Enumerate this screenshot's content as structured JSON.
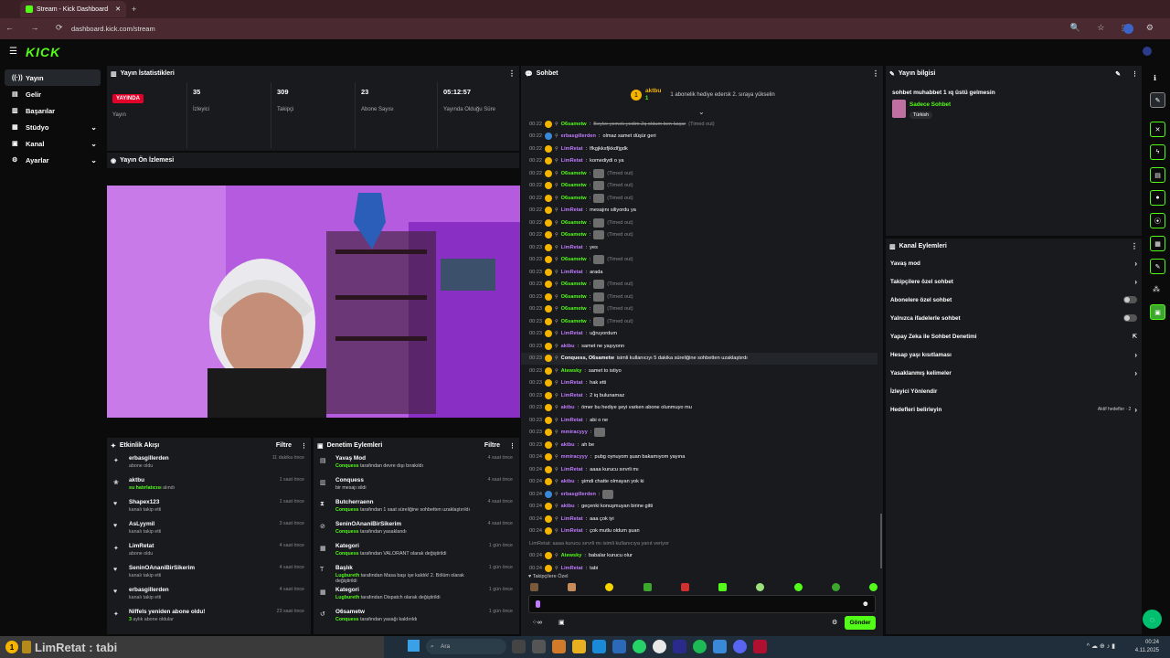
{
  "browser": {
    "tab_title": "Stream - Kick Dashboard",
    "url": "dashboard.kick.com/stream"
  },
  "brand": {
    "logo": "KICK",
    "accent": "#53fc18"
  },
  "nav": {
    "items": [
      {
        "label": "Yayın",
        "icon": "broadcast-icon"
      },
      {
        "label": "Gelir",
        "icon": "money-icon"
      },
      {
        "label": "Başarılar",
        "icon": "trophy-icon"
      },
      {
        "label": "Stüdyo",
        "icon": "studio-icon"
      },
      {
        "label": "Kanal",
        "icon": "channel-icon"
      },
      {
        "label": "Ayarlar",
        "icon": "gear-icon"
      }
    ]
  },
  "stats": {
    "title": "Yayın İstatistikleri",
    "live_badge": "YAYINDA",
    "live_label": "Yayın",
    "items": [
      {
        "value": "35",
        "label": "İzleyici"
      },
      {
        "value": "309",
        "label": "Takipçi"
      },
      {
        "value": "23",
        "label": "Abone Sayısı"
      },
      {
        "value": "05:12:57",
        "label": "Yayında Olduğu Süre"
      }
    ]
  },
  "preview": {
    "title": "Yayın Ön İzlemesi"
  },
  "activity": {
    "title": "Etkinlik Akışı",
    "filter": "Filtre",
    "items": [
      {
        "name": "erbasgillerden",
        "sub": "abone oldu",
        "time": "11 dakika önce"
      },
      {
        "name": "aktbu",
        "sub_hl": "su hatırlatıcısı",
        "sub": " alındı",
        "time": "1 saat önce"
      },
      {
        "name": "Shapex123",
        "sub": "kanalı takip etti",
        "time": "1 saat önce"
      },
      {
        "name": "AsLyymil",
        "sub": "kanalı takip etti",
        "time": "3 saat önce"
      },
      {
        "name": "LimRetat",
        "sub": "abone oldu",
        "time": "4 saat önce"
      },
      {
        "name": "SeninOAnaniBirSikerim",
        "sub": "kanalı takip etti",
        "time": "4 saat önce"
      },
      {
        "name": "erbasgillerden",
        "sub": "kanalı takip etti",
        "time": "4 saat önce"
      },
      {
        "name": "Niffels yeniden abone oldu!",
        "sub_hl": "3",
        "sub": " aylık abone oldular",
        "time": "23 saat önce"
      }
    ]
  },
  "moderation": {
    "title": "Denetim Eylemleri",
    "filter": "Filtre",
    "items": [
      {
        "name": "Yavaş Mod",
        "hl": "Conquess",
        "sub": " tarafından devre dışı bırakıldı",
        "time": "4 saat önce"
      },
      {
        "name": "Conquess",
        "hl": "",
        "sub": "bir mesajı sildi",
        "time": "4 saat önce"
      },
      {
        "name": "Butcherraenn",
        "hl": "Conquess",
        "sub": " tarafından 1 saat süreliğine sohbetten uzaklaştırıldı",
        "time": "4 saat önce"
      },
      {
        "name": "SeninOAnaniBirSikerim",
        "hl": "Conquess",
        "sub": " tarafından yasaklandı",
        "time": "4 saat önce"
      },
      {
        "name": "Kategori",
        "hl": "Conquess",
        "sub": " tarafından VALORANT olarak değiştirildi",
        "time": "1 gün önce"
      },
      {
        "name": "Başlık",
        "hl": "Lugbureth",
        "sub": " tarafından Masa başı işe kaldık! 2. Bölüm olarak değiştirildi",
        "time": "1 gün önce"
      },
      {
        "name": "Kategori",
        "hl": "Lugbureth",
        "sub": " tarafından Dispatch olarak değiştirildi",
        "time": "1 gün önce"
      },
      {
        "name": "O6sametw",
        "hl": "Conquess",
        "sub": " tarafından yasağı kaldırıldı",
        "time": "1 gün önce"
      }
    ]
  },
  "chat": {
    "title": "Sohbet",
    "pinned_user": "aktbu",
    "pinned_count": "1",
    "pinned_text": "1 abonelik hediye edersk 2. sıraya yükselin",
    "followers_only": "Takipçilere Özel",
    "send": "Gönder",
    "messages": [
      {
        "t": "00:22",
        "u": "O6sametw",
        "c": "#53fc18",
        "m": "Beyler yemek yedim 2q oldum ben kaçar",
        "x": "(Timed out)"
      },
      {
        "t": "00:22",
        "u": "erbasgillerden",
        "c": "#c07bff",
        "m": "olmaz samet düşür geri"
      },
      {
        "t": "00:22",
        "u": "LimRetat",
        "c": "#c07bff",
        "m": "lfkgjkksfjkkdfjgdk"
      },
      {
        "t": "00:22",
        "u": "LimRetat",
        "c": "#c07bff",
        "m": "komediydi o ya"
      },
      {
        "t": "00:22",
        "u": "O6sametw",
        "c": "#53fc18",
        "m": "",
        "x": "(Timed out)",
        "e": true
      },
      {
        "t": "00:22",
        "u": "O6sametw",
        "c": "#53fc18",
        "m": "",
        "x": "(Timed out)",
        "e": true
      },
      {
        "t": "00:22",
        "u": "O6sametw",
        "c": "#53fc18",
        "m": "",
        "x": "(Timed out)",
        "e": true
      },
      {
        "t": "00:22",
        "u": "LimRetat",
        "c": "#c07bff",
        "m": "mesajını siliyordu ya"
      },
      {
        "t": "00:22",
        "u": "O6sametw",
        "c": "#53fc18",
        "m": "",
        "x": "(Timed out)",
        "e": true
      },
      {
        "t": "00:22",
        "u": "O6sametw",
        "c": "#53fc18",
        "m": "",
        "x": "(Timed out)",
        "e": true
      },
      {
        "t": "00:23",
        "u": "LimRetat",
        "c": "#c07bff",
        "m": "yes"
      },
      {
        "t": "00:23",
        "u": "O6sametw",
        "c": "#53fc18",
        "m": "",
        "x": "(Timed out)",
        "e": true
      },
      {
        "t": "00:23",
        "u": "LimRetat",
        "c": "#c07bff",
        "m": "arada"
      },
      {
        "t": "00:23",
        "u": "O6sametw",
        "c": "#53fc18",
        "m": "",
        "x": "(Timed out)",
        "e": true
      },
      {
        "t": "00:23",
        "u": "O6sametw",
        "c": "#53fc18",
        "m": "",
        "x": "(Timed out)",
        "e": true
      },
      {
        "t": "00:23",
        "u": "O6sametw",
        "c": "#53fc18",
        "m": "",
        "x": "(Timed out)",
        "e": true
      },
      {
        "t": "00:23",
        "u": "O6sametw",
        "c": "#53fc18",
        "m": "",
        "x": "(Timed out)",
        "e": true
      },
      {
        "t": "00:23",
        "u": "LimRetat",
        "c": "#c07bff",
        "m": "uğruyordum"
      },
      {
        "t": "00:23",
        "u": "aktbu",
        "c": "#c07bff",
        "m": "samet ne yaşıyonn"
      },
      {
        "t": "00:23",
        "u": "Conquess, O6sametw",
        "c": "#ffffff",
        "m": "isimli kullanıcıyı 5 dakika süreliğine sohbetten uzaklaştırdı",
        "sys": true
      },
      {
        "t": "00:23",
        "u": "Atewsky",
        "c": "#53fc18",
        "m": "samet to istiyo"
      },
      {
        "t": "00:23",
        "u": "LimRetat",
        "c": "#c07bff",
        "m": "hak etti"
      },
      {
        "t": "00:23",
        "u": "LimRetat",
        "c": "#c07bff",
        "m": "2 iq bulunamaz"
      },
      {
        "t": "00:23",
        "u": "aktbu",
        "c": "#c07bff",
        "m": "ömer bu hediye şeyi varken abone olunmuyo mu"
      },
      {
        "t": "00:23",
        "u": "LimRetat",
        "c": "#c07bff",
        "m": "abi o ne"
      },
      {
        "t": "00:23",
        "u": "mmiracyyy",
        "c": "#c07bff",
        "m": "",
        "e": true
      },
      {
        "t": "00:23",
        "u": "aktbu",
        "c": "#c07bff",
        "m": "ah be"
      },
      {
        "t": "00:24",
        "u": "mmiracyyy",
        "c": "#c07bff",
        "m": "pubg oynuyom şuan bakamıyom yayına"
      },
      {
        "t": "00:24",
        "u": "LimRetat",
        "c": "#c07bff",
        "m": "aaaa kurucu sırvrli mı"
      },
      {
        "t": "00:24",
        "u": "aktbu",
        "c": "#c07bff",
        "m": "şimdi chatte olmayan yok ki"
      },
      {
        "t": "00:24",
        "u": "erbasgillerden",
        "c": "#c07bff",
        "m": "",
        "e": true
      },
      {
        "t": "00:24",
        "u": "aktbu",
        "c": "#c07bff",
        "m": "geçenki konuşmuyan birine gitti"
      },
      {
        "t": "00:24",
        "u": "LimRetat",
        "c": "#c07bff",
        "m": "aaa çok iyi"
      },
      {
        "t": "00:24",
        "u": "LimRetat",
        "c": "#c07bff",
        "m": "çok mutlu oldum şuan"
      },
      {
        "t": "",
        "u": "",
        "c": "#888888",
        "m": "LimRetat: aaaa kurucu sırvrli mı isimli kullanıcıya yanıt veriyor",
        "reply": true
      },
      {
        "t": "00:24",
        "u": "Atewsky",
        "c": "#53fc18",
        "m": "babalar kurucu olur"
      },
      {
        "t": "00:24",
        "u": "LimRetat",
        "c": "#c07bff",
        "m": "tabi"
      }
    ]
  },
  "stream_info": {
    "title": "Yayın bilgisi",
    "stream_title": "sohbet muhabbet 1 ıq üstü gelmesin",
    "category": "Sadece Sohbet",
    "language": "Türkish"
  },
  "channel_actions": {
    "title": "Kanal Eylemleri",
    "items": [
      {
        "label": "Yavaş mod",
        "type": "chevron"
      },
      {
        "label": "Takipçilere özel sohbet",
        "type": "chevron"
      },
      {
        "label": "Abonelere özel sohbet",
        "type": "toggle"
      },
      {
        "label": "Yalnızca ifadelerle sohbet",
        "type": "toggle"
      },
      {
        "label": "Yapay Zeka ile Sohbet Denetimi",
        "type": "external"
      },
      {
        "label": "Hesap yaşı kısıtlaması",
        "type": "chevron"
      },
      {
        "label": "Yasaklanmış kelimeler",
        "type": "chevron"
      },
      {
        "label": "İzleyici Yönlendir",
        "type": "none"
      },
      {
        "label": "Hedefleri belirleyin",
        "type": "goal"
      }
    ],
    "goal_badge": "Aktif hedefler · 2"
  },
  "taskbar": {
    "ticker": "LimRetat : tabi",
    "search": "Ara",
    "time": "00:24",
    "date": "4.11.2025"
  }
}
